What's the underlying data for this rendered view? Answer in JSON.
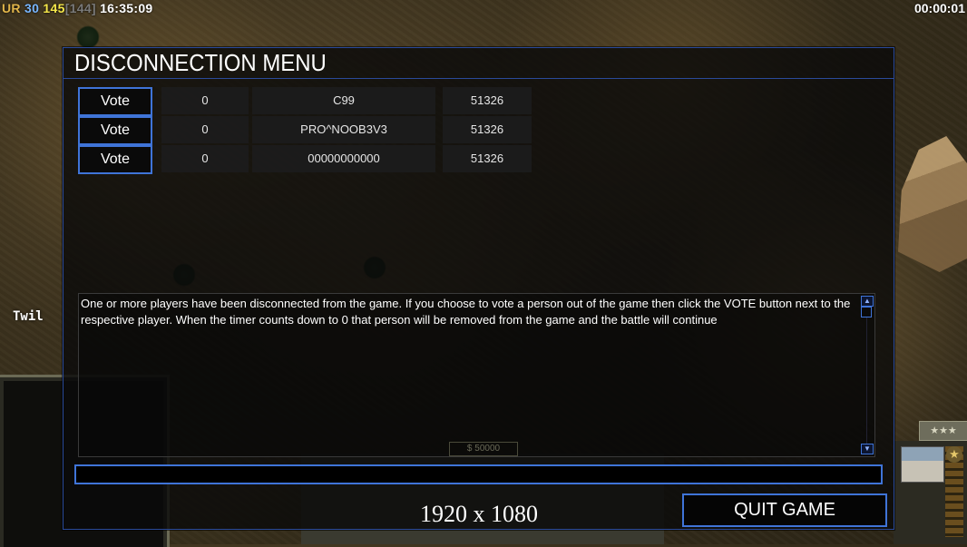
{
  "hud": {
    "faction_tag": "UR",
    "stat_a": "30",
    "stat_b": "145",
    "stat_c": "[144]",
    "clock": "16:35:09",
    "game_timer": "00:00:01",
    "player_tag": "Twil",
    "rank_stars": "★★★",
    "money_ghost": "$ 50000"
  },
  "dialog": {
    "title": "DISCONNECTION MENU",
    "players": [
      {
        "vote_label": "Vote",
        "votes": "0",
        "name": "C99",
        "timer": "51326"
      },
      {
        "vote_label": "Vote",
        "votes": "0",
        "name": "PRO^NOOB3V3",
        "timer": "51326"
      },
      {
        "vote_label": "Vote",
        "votes": "0",
        "name": "00000000000",
        "timer": "51326"
      }
    ],
    "message": "One or more players have been disconnected from the game. If you choose to vote a person out of the game then click the VOTE button next to the respective player. When the timer counts down to 0 that person will be removed from the game and the battle will continue",
    "chat_input_value": "",
    "quit_label": "QUIT GAME",
    "resolution_label": "1920 x 1080"
  },
  "colors": {
    "accent_border": "#3f74d8",
    "faction_color": "#e2b64a",
    "stat_a_color": "#79b7ff",
    "stat_b_color": "#f6e84a"
  },
  "icons": [
    "scroll-up-icon",
    "scroll-down-icon",
    "rank-star-icon"
  ]
}
